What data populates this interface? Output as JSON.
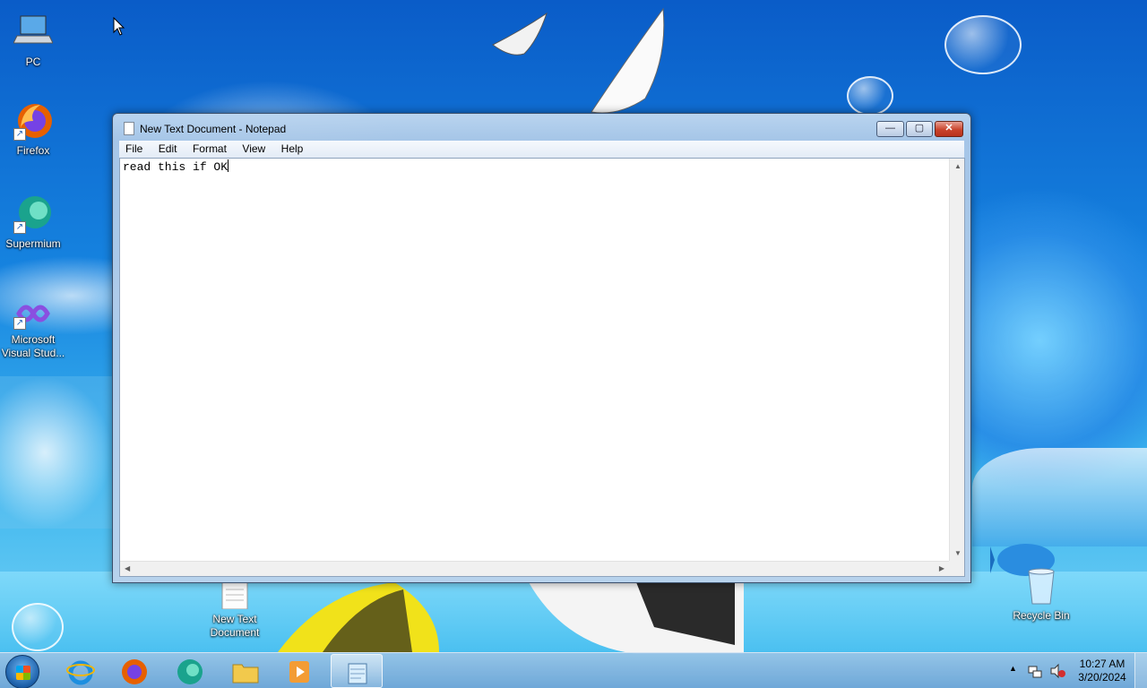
{
  "desktop": {
    "icons": [
      {
        "label": "PC",
        "icon": "computer-icon"
      },
      {
        "label": "Firefox",
        "icon": "firefox-icon"
      },
      {
        "label": "Supermium",
        "icon": "supermium-icon"
      },
      {
        "label": "Microsoft Visual Stud...",
        "label_line1": "Microsoft",
        "label_line2": "Visual Stud...",
        "icon": "visual-studio-icon"
      },
      {
        "label": "New Text Document",
        "label_line1": "New Text",
        "label_line2": "Document",
        "icon": "text-file-icon"
      },
      {
        "label": "Recycle Bin",
        "icon": "recycle-bin-icon"
      }
    ]
  },
  "notepad": {
    "title": "New Text Document - Notepad",
    "menu": [
      "File",
      "Edit",
      "Format",
      "View",
      "Help"
    ],
    "content": "read this if OK",
    "buttons": {
      "minimize": "—",
      "maximize": "▢",
      "close": "✕"
    }
  },
  "taskbar": {
    "apps": [
      {
        "name": "Internet Explorer",
        "icon": "internet-explorer-icon"
      },
      {
        "name": "Firefox",
        "icon": "firefox-icon"
      },
      {
        "name": "Supermium",
        "icon": "supermium-icon"
      },
      {
        "name": "File Explorer",
        "icon": "folder-icon"
      },
      {
        "name": "Windows Media Player",
        "icon": "media-player-icon"
      },
      {
        "name": "Notepad",
        "icon": "notepad-icon",
        "active": true
      }
    ],
    "clock": {
      "time": "10:27 AM",
      "date": "3/20/2024"
    }
  },
  "colors": {
    "accent": "#1684e0",
    "close_button": "#c9432c"
  }
}
